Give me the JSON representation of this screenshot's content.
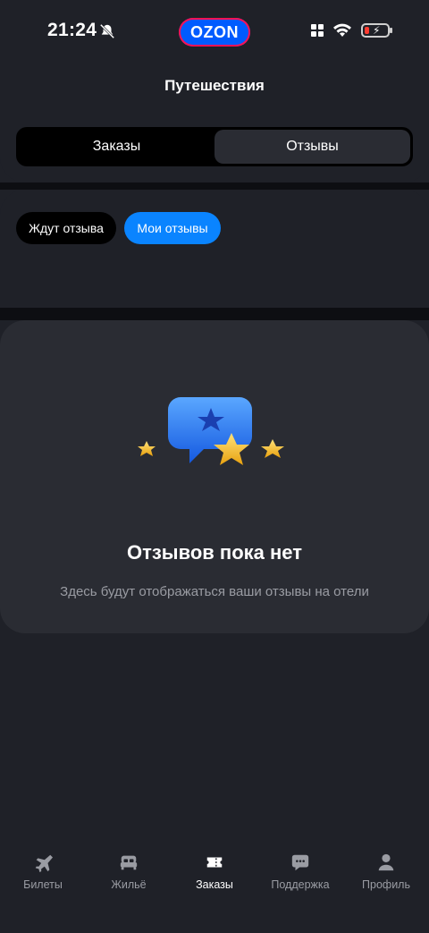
{
  "status_bar": {
    "time": "21:24",
    "brand": "OZON"
  },
  "header": {
    "title": "Путешествия",
    "segments": [
      {
        "label": "Заказы",
        "active": false
      },
      {
        "label": "Отзывы",
        "active": true
      }
    ]
  },
  "filters": {
    "chips": [
      {
        "label": "Ждут отзыва",
        "active": false
      },
      {
        "label": "Мои отзывы",
        "active": true
      }
    ]
  },
  "empty_state": {
    "title": "Отзывов пока нет",
    "subtitle": "Здесь будут отображаться ваши отзывы на отели"
  },
  "tab_bar": {
    "tabs": [
      {
        "label": "Билеты",
        "icon": "plane-icon",
        "active": false
      },
      {
        "label": "Жильё",
        "icon": "bed-icon",
        "active": false
      },
      {
        "label": "Заказы",
        "icon": "ticket-icon",
        "active": true
      },
      {
        "label": "Поддержка",
        "icon": "chat-icon",
        "active": false
      },
      {
        "label": "Профиль",
        "icon": "user-icon",
        "active": false
      }
    ]
  },
  "colors": {
    "accent": "#0a84ff",
    "background": "#1f2128",
    "card": "#2a2c33",
    "star": "#f5c21b"
  }
}
